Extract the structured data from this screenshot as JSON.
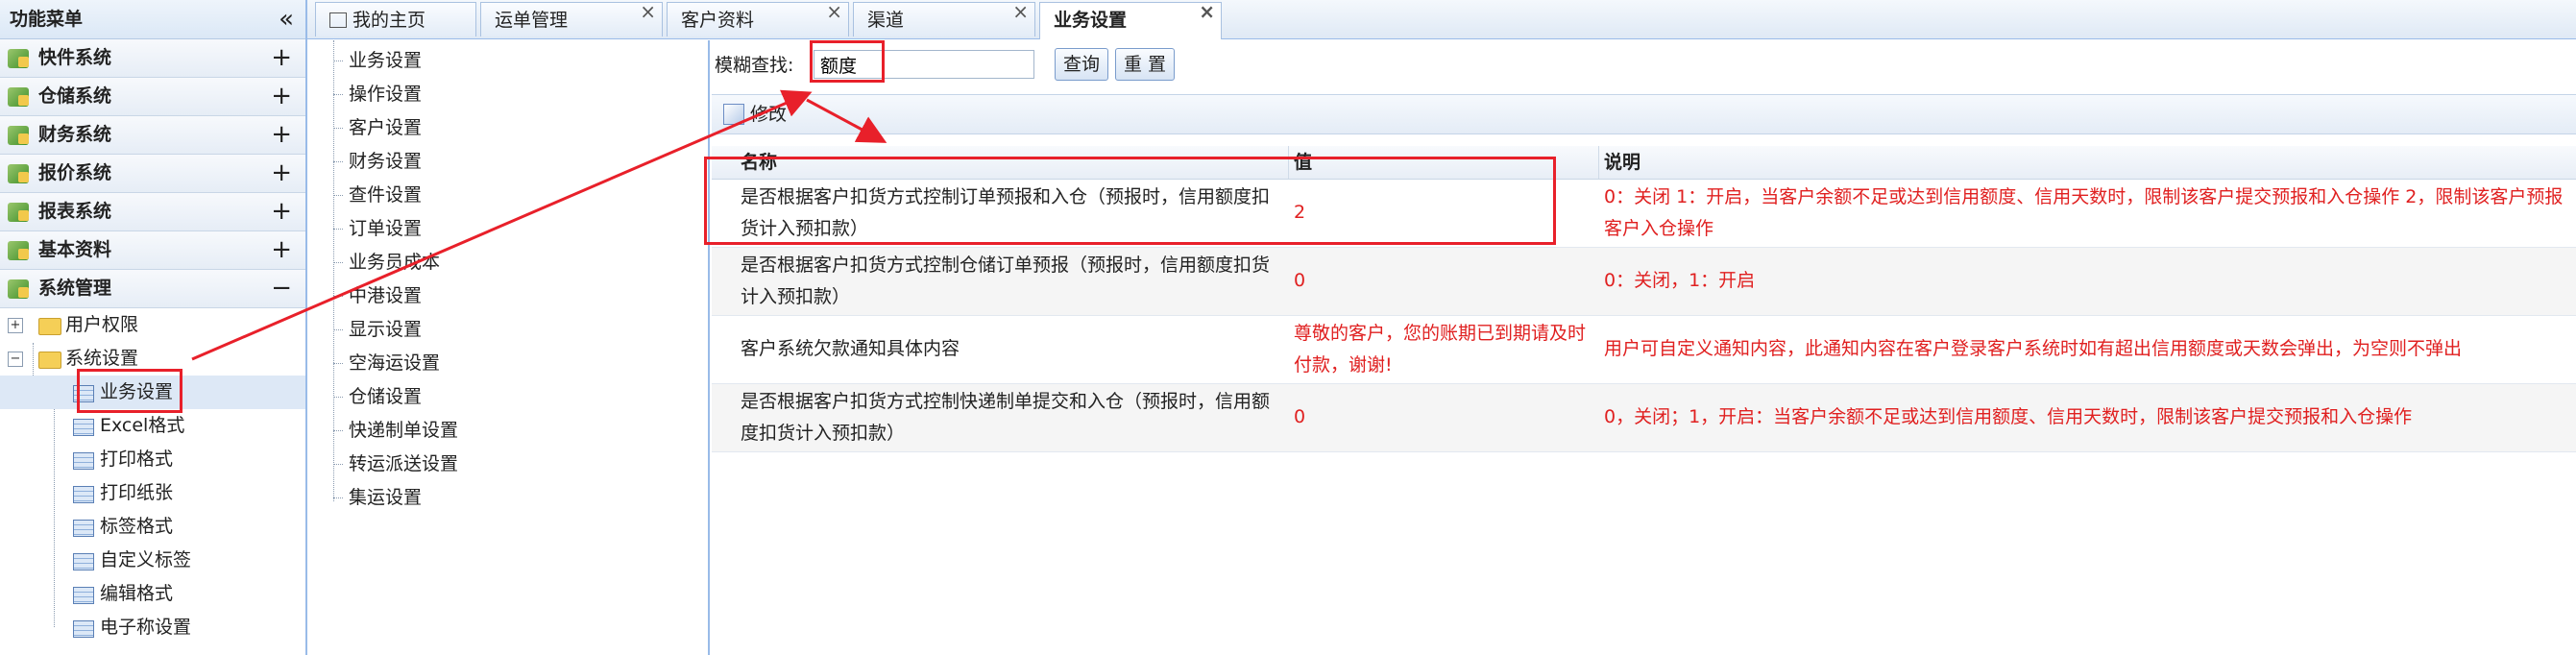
{
  "left_menu": {
    "title": "功能菜单",
    "collapse_icon": "double-chevron-left-icon",
    "sections": [
      {
        "label": "快件系统",
        "state": "+"
      },
      {
        "label": "仓储系统",
        "state": "+"
      },
      {
        "label": "财务系统",
        "state": "+"
      },
      {
        "label": "报价系统",
        "state": "+"
      },
      {
        "label": "报表系统",
        "state": "+"
      },
      {
        "label": "基本资料",
        "state": "+"
      },
      {
        "label": "系统管理",
        "state": "−"
      }
    ],
    "tree": {
      "user_perm": "用户权限",
      "sys_settings": "系统设置",
      "children": [
        "业务设置",
        "Excel格式",
        "打印格式",
        "打印纸张",
        "标签格式",
        "自定义标签",
        "编辑格式",
        "电子称设置"
      ]
    }
  },
  "tabs": [
    {
      "label": "我的主页"
    },
    {
      "label": "运单管理"
    },
    {
      "label": "客户资料"
    },
    {
      "label": "渠道"
    },
    {
      "label": "业务设置"
    }
  ],
  "settings_list": [
    "业务设置",
    "操作设置",
    "客户设置",
    "财务设置",
    "查件设置",
    "订单设置",
    "业务员成本",
    "中港设置",
    "显示设置",
    "空海运设置",
    "仓储设置",
    "快递制单设置",
    "转运派送设置",
    "集运设置"
  ],
  "search": {
    "label": "模糊查找:",
    "value": "额度",
    "query_button": "查询",
    "reset_button": "重 置"
  },
  "toolbar": {
    "edit_label": "修改"
  },
  "grid": {
    "headers": [
      "名称",
      "值",
      "说明"
    ],
    "rows": [
      {
        "name_line1": "是否根据客户扣货方式控制订单预报和入仓（预报时，信用额度扣",
        "name_line2": "货计入预扣款）",
        "value_line1": "2",
        "value_line2": "",
        "desc_line1": "0：关闭 1：开启，当客户余额不足或达到信用额度、信用天数时，限制该客户提交预报和入仓操作 2，限制该客户预报",
        "desc_line2": "客户入仓操作"
      },
      {
        "name_line1": "是否根据客户扣货方式控制仓储订单预报（预报时，信用额度扣货",
        "name_line2": "计入预扣款）",
        "value_line1": "0",
        "value_line2": "",
        "desc_line1": "0：关闭，1：开启",
        "desc_line2": ""
      },
      {
        "name_line1": "客户系统欠款通知具体内容",
        "name_line2": "",
        "value_line1": "尊敬的客户，您的账期已到期请及时",
        "value_line2": "付款，谢谢!",
        "desc_line1": "用户可自定义通知内容，此通知内容在客户登录客户系统时如有超出信用额度或天数会弹出，为空则不弹出",
        "desc_line2": ""
      },
      {
        "name_line1": "是否根据客户扣货方式控制快递制单提交和入仓（预报时，信用额",
        "name_line2": "度扣货计入预扣款）",
        "value_line1": "0",
        "value_line2": "",
        "desc_line1": "0，关闭；1，开启：当客户余额不足或达到信用额度、信用天数时，限制该客户提交预报和入仓操作",
        "desc_line2": ""
      }
    ]
  },
  "colors": {
    "annotation": "#e8202a",
    "value_text": "#e02020",
    "border": "#99bbe8"
  }
}
